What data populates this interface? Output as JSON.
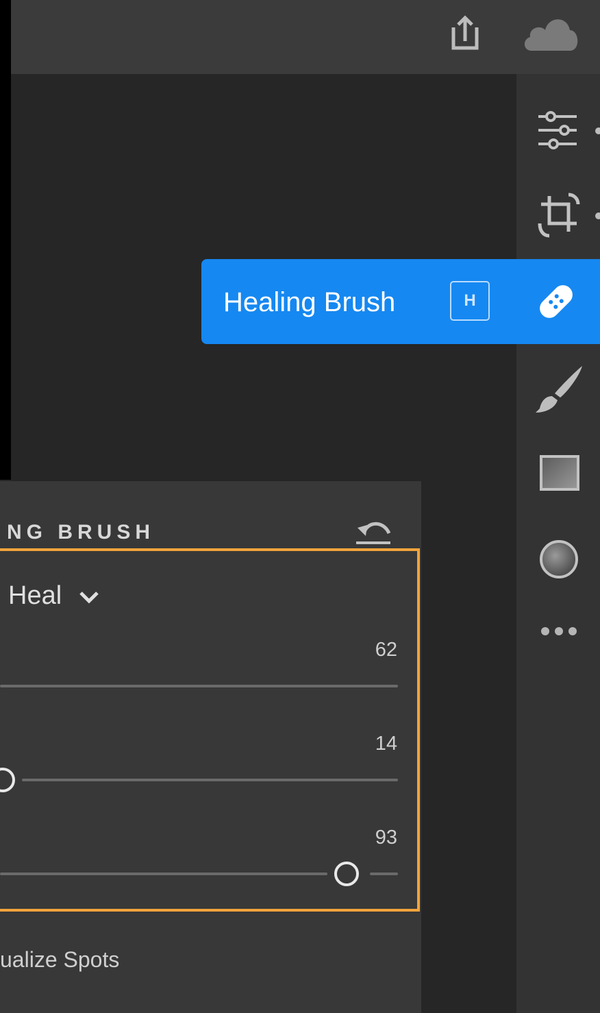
{
  "toolbar": {
    "share_icon": "share-icon",
    "cloud_icon": "cloud-icon"
  },
  "tools": [
    {
      "name": "edit-sliders-icon"
    },
    {
      "name": "crop-rotate-icon"
    },
    {
      "name": "healing-brush-icon"
    },
    {
      "name": "brush-icon"
    },
    {
      "name": "linear-gradient-icon"
    },
    {
      "name": "radial-gradient-icon"
    },
    {
      "name": "more-icon"
    }
  ],
  "tooltip": {
    "label": "Healing Brush",
    "shortcut": "H"
  },
  "panel": {
    "title": "NG BRUSH",
    "mode": "Heal",
    "sliders": [
      {
        "value": "62"
      },
      {
        "value": "14"
      },
      {
        "value": "93"
      }
    ],
    "visualize_label": "ualize Spots"
  },
  "colors": {
    "accent_blue": "#1688f1",
    "highlight_orange": "#f1a43c"
  }
}
